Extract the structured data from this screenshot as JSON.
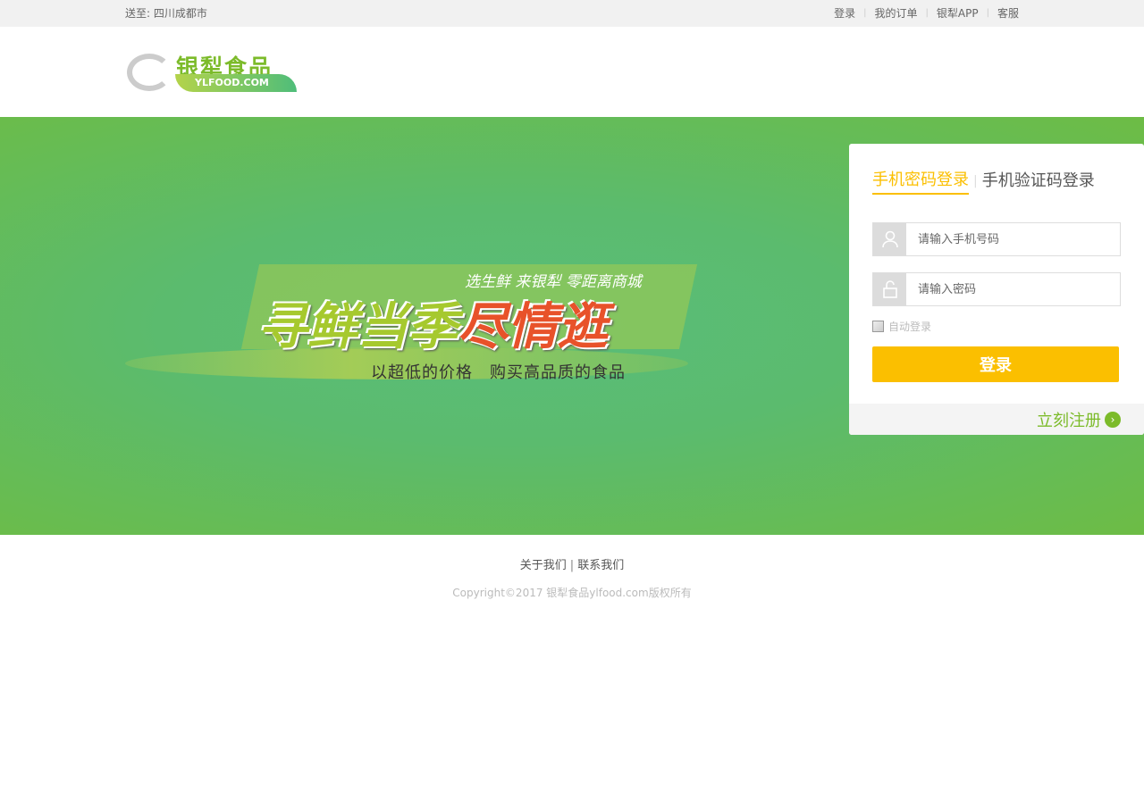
{
  "topbar": {
    "location": "送至: 四川成都市",
    "links": [
      "登录",
      "我的订单",
      "银犁APP",
      "客服"
    ]
  },
  "logo": {
    "cn": "银犁食品",
    "en": "YLFOOD.COM"
  },
  "banner": {
    "subtitle": "选生鲜 来银犁 零距离商城",
    "headline_a": "寻鲜当季",
    "headline_b": "尽情逛",
    "tagline": "以超低的价格　购买高品质的食品"
  },
  "login": {
    "tabs": [
      {
        "label": "手机密码登录",
        "active": true
      },
      {
        "label": "手机验证码登录",
        "active": false
      }
    ],
    "phone_placeholder": "请输入手机号码",
    "password_placeholder": "请输入密码",
    "auto_login": "自动登录",
    "submit": "登录",
    "register": "立刻注册",
    "accent": "#fbbf00"
  },
  "footer": {
    "links": [
      "关于我们",
      "联系我们"
    ],
    "copyright": "Copyright©2017 银犁食品ylfood.com版权所有"
  }
}
